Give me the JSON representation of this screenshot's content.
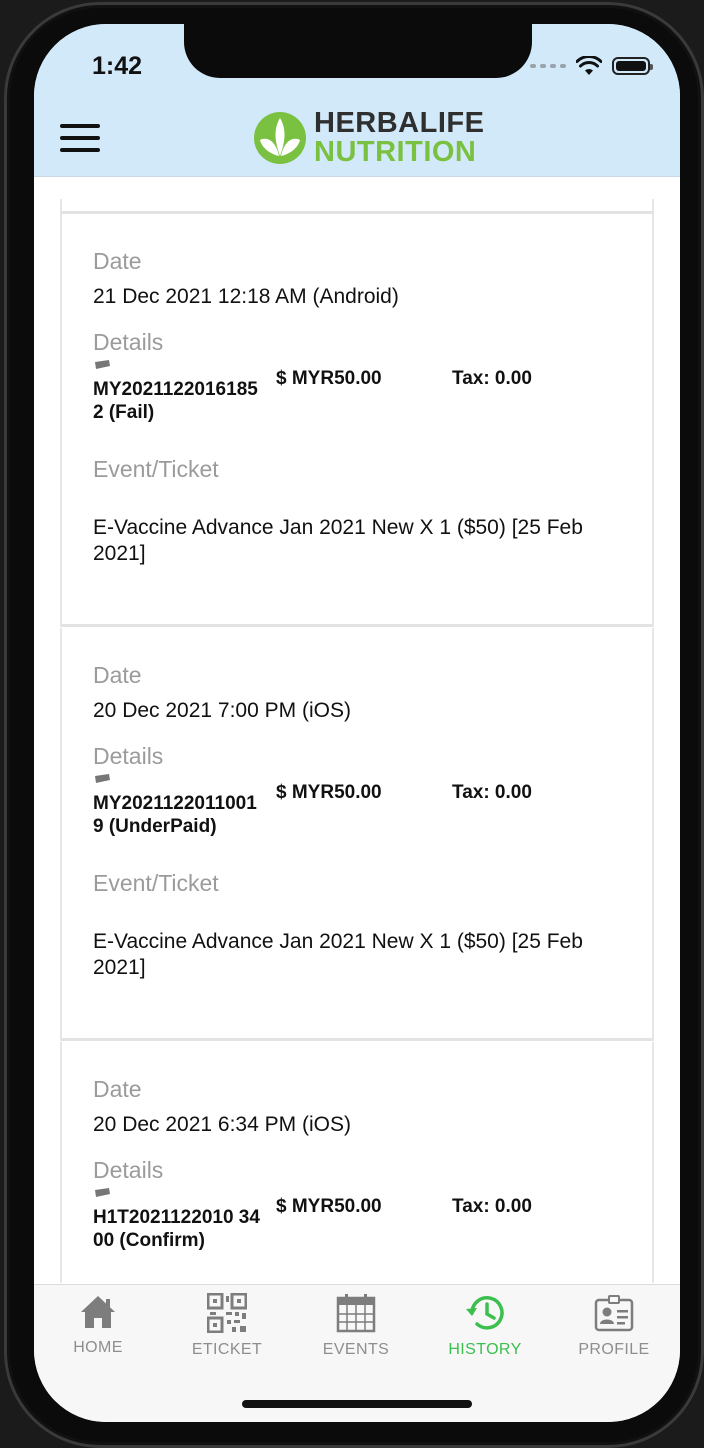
{
  "status_bar": {
    "time": "1:42"
  },
  "brand": {
    "line1": "HERBALIFE",
    "line2": "NUTRITION"
  },
  "labels": {
    "date": "Date",
    "details": "Details",
    "event_ticket": "Event/Ticket"
  },
  "transactions": [
    {
      "date": "21 Dec 2021  12:18 AM  (Android)",
      "ticket_no": "MY20211220161852 (Fail)",
      "amount": "$  MYR50.00",
      "tax": "Tax: 0.00",
      "event": "E-Vaccine  Advance Jan 2021 New X 1 ($50)  [25 Feb 2021]"
    },
    {
      "date": "20 Dec 2021  7:00 PM  (iOS)",
      "ticket_no": "MY20211220110019 (UnderPaid)",
      "amount": "$  MYR50.00",
      "tax": "Tax: 0.00",
      "event": "E-Vaccine  Advance Jan 2021 New X 1 ($50)  [25 Feb 2021]"
    },
    {
      "date": "20 Dec 2021  6:34 PM  (iOS)",
      "ticket_no": "H1T2021122010 3400 (Confirm)",
      "amount": "$  MYR50.00",
      "tax": "Tax: 0.00",
      "event": ""
    }
  ],
  "tabs": [
    {
      "label": "HOME",
      "icon": "home-icon"
    },
    {
      "label": "ETICKET",
      "icon": "qr-code-icon"
    },
    {
      "label": "EVENTS",
      "icon": "calendar-icon"
    },
    {
      "label": "HISTORY",
      "icon": "history-icon",
      "active": true
    },
    {
      "label": "PROFILE",
      "icon": "profile-card-icon"
    }
  ],
  "colors": {
    "appbar": "#d2e9fa",
    "brand_green": "#7ac142",
    "active_tab": "#3bbf4e"
  }
}
